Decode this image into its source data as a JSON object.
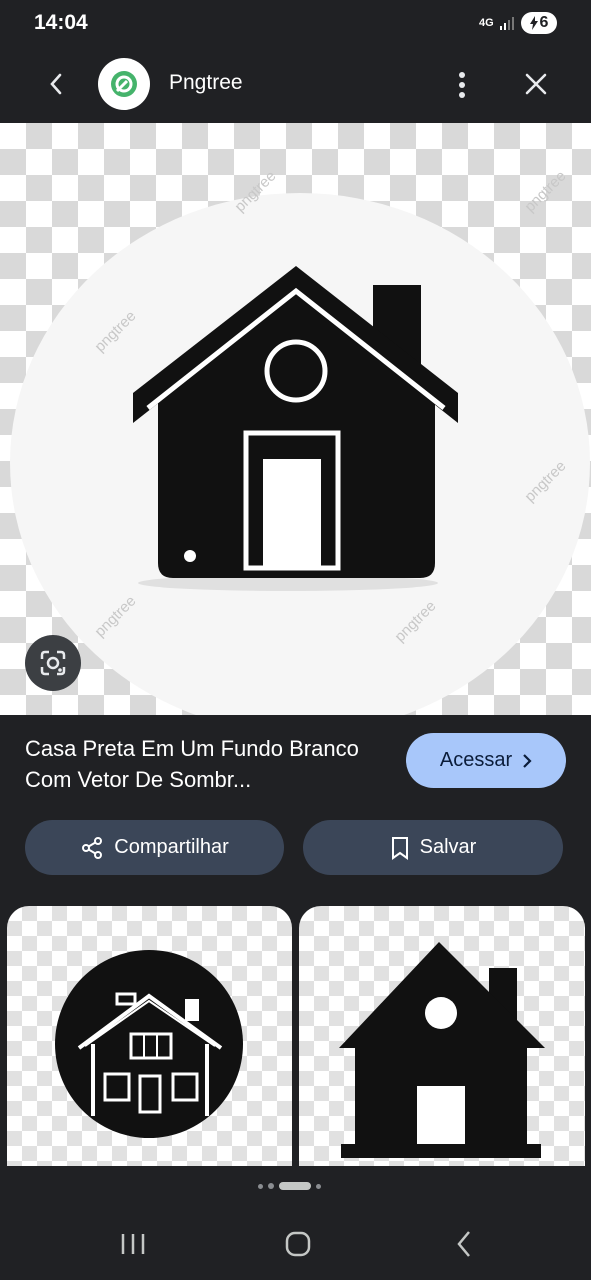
{
  "status_bar": {
    "time": "14:04",
    "network": "4G",
    "battery": "6"
  },
  "header": {
    "title": "Pngtree"
  },
  "hero": {
    "watermark": "pngtree"
  },
  "result": {
    "title": "Casa Preta Em Um Fundo Branco Com Vetor De Sombr...",
    "visit_label": "Acessar"
  },
  "actions": {
    "share_label": "Compartilhar",
    "save_label": "Salvar"
  },
  "pagination": {
    "total": 4,
    "active": 3
  },
  "icons": {
    "back": "back-arrow-icon",
    "logo": "pngtree-logo-icon",
    "more": "more-vert-icon",
    "close": "close-icon",
    "lens": "google-lens-icon",
    "share": "share-icon",
    "bookmark": "bookmark-icon",
    "chevron": "chevron-right-icon",
    "nav_recents": "recents-icon",
    "nav_home": "home-icon",
    "nav_back": "nav-back-icon"
  },
  "colors": {
    "accent_button": "#a8c7fa",
    "secondary_button": "#3b4658",
    "background": "#202124"
  }
}
